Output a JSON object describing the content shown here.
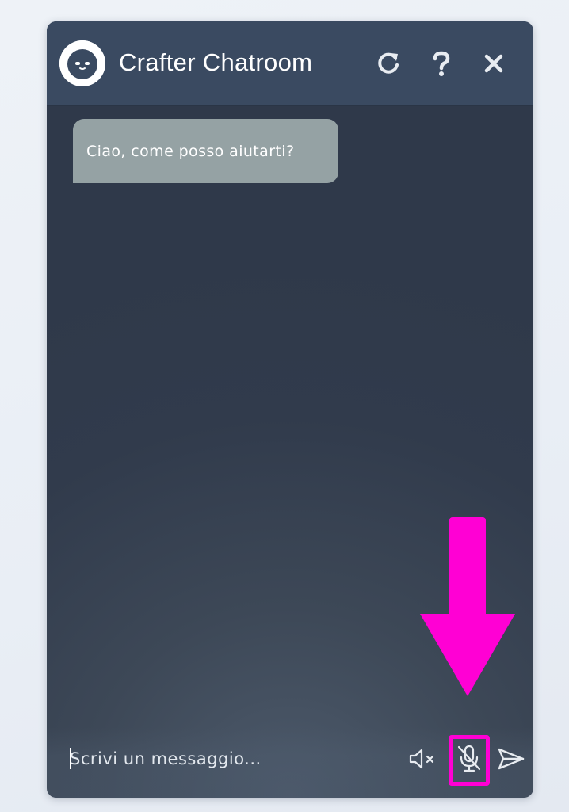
{
  "header": {
    "title": "Crafter Chatroom",
    "icons": {
      "avatar": "smiley-face-icon",
      "refresh": "refresh-icon",
      "help": "question-mark-icon",
      "close": "close-icon"
    }
  },
  "conversation": {
    "messages": [
      {
        "sender": "bot",
        "text": "Ciao, come posso aiutarti?"
      }
    ]
  },
  "composer": {
    "placeholder": "Scrivi un messaggio...",
    "value": "",
    "icons": {
      "mute": "speaker-muted-icon",
      "mic": "microphone-off-icon",
      "send": "send-icon"
    }
  },
  "annotation": {
    "icon": "arrow-down-icon"
  },
  "colors": {
    "header_bg": "#3a4a61",
    "panel_bg": "#313b4c",
    "bubble_bg": "#95a2a4",
    "highlight": "#ff00d4",
    "text": "#ffffff"
  }
}
